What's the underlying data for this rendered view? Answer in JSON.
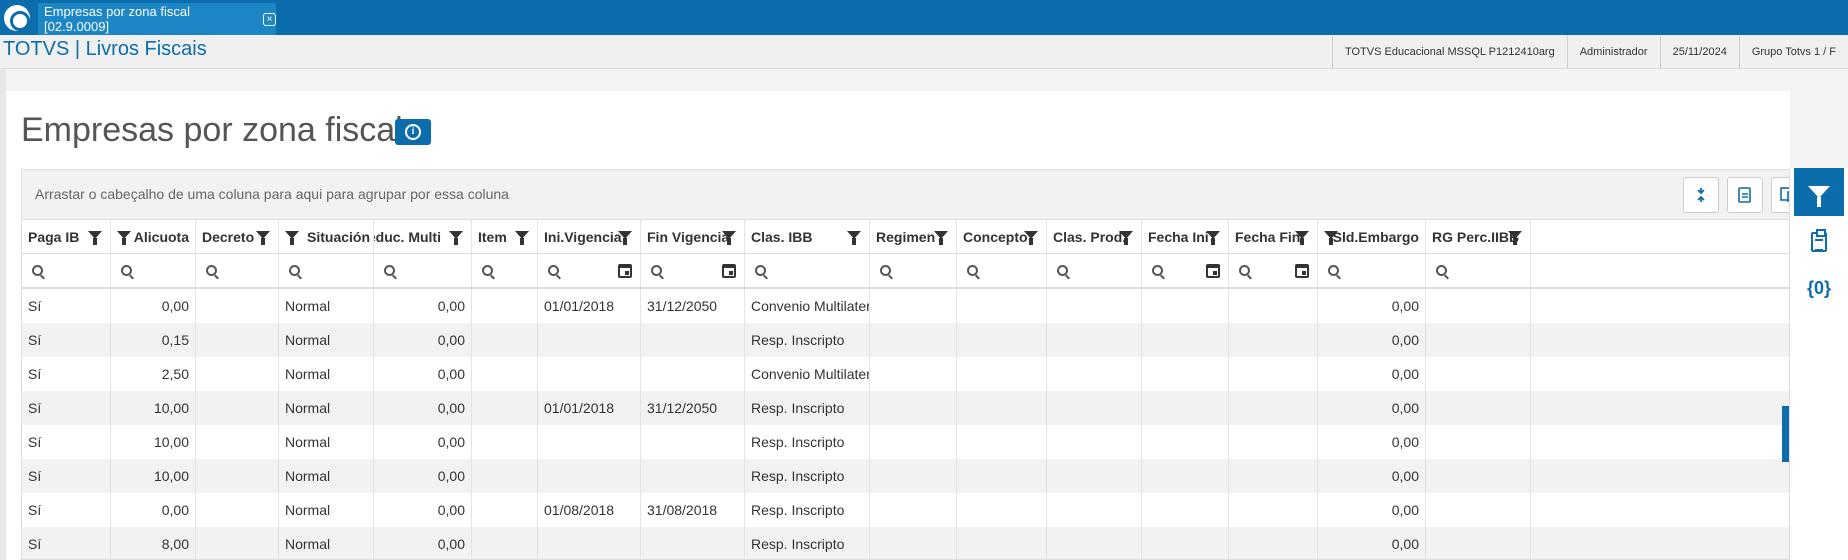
{
  "tab": {
    "title": "Empresas por zona fiscal [02.9.0009]",
    "close": "×"
  },
  "header": {
    "app_title": "TOTVS | Livros Fiscais",
    "environment": "TOTVS Educacional MSSQL P1212410arg",
    "user": "Administrador",
    "date": "25/11/2024",
    "company": "Grupo Totvs 1 / F"
  },
  "page": {
    "title": "Empresas por zona fiscal",
    "info_icon": "i"
  },
  "grid": {
    "group_hint": "Arrastar o cabeçalho de uma coluna para aqui para agrupar por essa coluna",
    "columns": [
      "Paga IB",
      "Alicuota",
      "Decreto",
      "Situación",
      "Reduc. Multi",
      "Item",
      "Ini.Vigencia",
      "Fin Vigencia",
      "Clas. IBB",
      "Regimen",
      "Concepto",
      "Clas. Prod.",
      "Fecha Ini",
      "Fecha Fin",
      "Sld.Embargo",
      "RG Perc.IIBB"
    ],
    "rows": [
      [
        "Sí",
        "0,00",
        "",
        "Normal",
        "0,00",
        "",
        "01/01/2018",
        "31/12/2050",
        "Convenio Multilateral",
        "",
        "",
        "",
        "",
        "",
        "0,00",
        ""
      ],
      [
        "Sí",
        "0,15",
        "",
        "Normal",
        "0,00",
        "",
        "",
        "",
        "Resp. Inscripto",
        "",
        "",
        "",
        "",
        "",
        "0,00",
        ""
      ],
      [
        "Sí",
        "2,50",
        "",
        "Normal",
        "0,00",
        "",
        "",
        "",
        "Convenio Multilateral",
        "",
        "",
        "",
        "",
        "",
        "0,00",
        ""
      ],
      [
        "Sí",
        "10,00",
        "",
        "Normal",
        "0,00",
        "",
        "01/01/2018",
        "31/12/2050",
        "Resp. Inscripto",
        "",
        "",
        "",
        "",
        "",
        "0,00",
        ""
      ],
      [
        "Sí",
        "10,00",
        "",
        "Normal",
        "0,00",
        "",
        "",
        "",
        "Resp. Inscripto",
        "",
        "",
        "",
        "",
        "",
        "0,00",
        ""
      ],
      [
        "Sí",
        "10,00",
        "",
        "Normal",
        "0,00",
        "",
        "",
        "",
        "Resp. Inscripto",
        "",
        "",
        "",
        "",
        "",
        "0,00",
        ""
      ],
      [
        "Sí",
        "0,00",
        "",
        "Normal",
        "0,00",
        "",
        "01/08/2018",
        "31/08/2018",
        "Resp. Inscripto",
        "",
        "",
        "",
        "",
        "",
        "0,00",
        ""
      ],
      [
        "Sí",
        "8,00",
        "",
        "Normal",
        "0,00",
        "",
        "",
        "",
        "Resp. Inscripto",
        "",
        "",
        "",
        "",
        "",
        "0,00",
        ""
      ]
    ]
  },
  "side_panel": {
    "variables_label": "{0}"
  }
}
